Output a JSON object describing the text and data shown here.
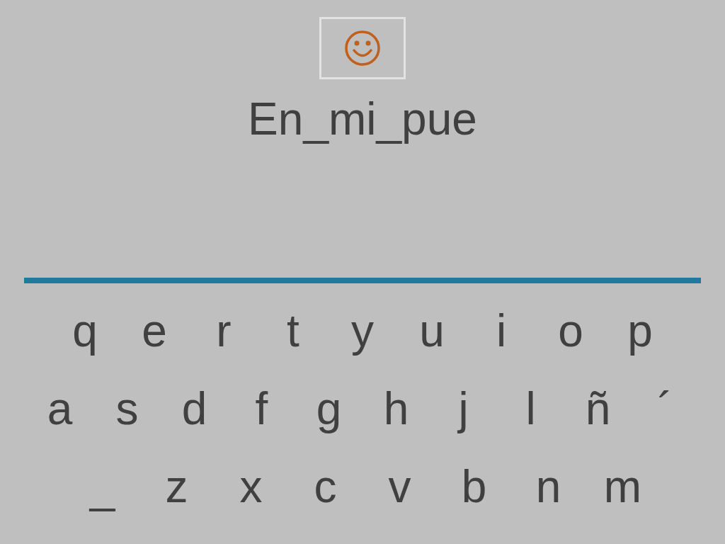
{
  "word": "En_mi_pue",
  "keyboard": {
    "rows": [
      [
        "q",
        "e",
        "r",
        "t",
        "y",
        "u",
        "i",
        "o",
        "p"
      ],
      [
        "a",
        "s",
        "d",
        "f",
        "g",
        "h",
        "j",
        "l",
        "ñ",
        "´"
      ],
      [
        "_",
        "z",
        "x",
        "c",
        "v",
        "b",
        "n",
        "m"
      ]
    ]
  }
}
